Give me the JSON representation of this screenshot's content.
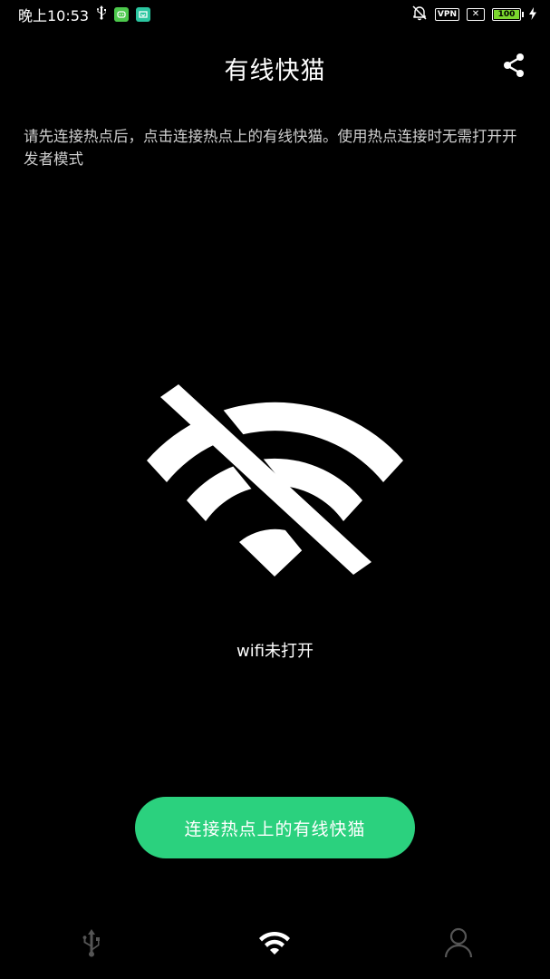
{
  "status_bar": {
    "time": "晚上10:53",
    "vpn_label": "VPN",
    "battery_level": "100",
    "icons": [
      "usb-icon",
      "app-notification-icon",
      "app-notification-icon-2",
      "mute-bell-icon",
      "vpn-icon",
      "no-sim-icon",
      "battery-icon",
      "charging-icon"
    ]
  },
  "header": {
    "title": "有线快猫",
    "share_icon": "share-icon"
  },
  "hint_text": "请先连接热点后，点击连接热点上的有线快猫。使用热点连接时无需打开开发者模式",
  "wifi": {
    "icon": "wifi-off-icon",
    "status": "wifi未打开"
  },
  "primary_button": {
    "label": "连接热点上的有线快猫",
    "color": "#2bd17e"
  },
  "bottom_nav": {
    "items": [
      {
        "icon": "usb-icon",
        "active": false
      },
      {
        "icon": "wifi-icon",
        "active": true
      },
      {
        "icon": "user-icon",
        "active": false
      }
    ]
  },
  "colors": {
    "background": "#000000",
    "accent": "#2bd17e",
    "inactive": "#555555"
  }
}
